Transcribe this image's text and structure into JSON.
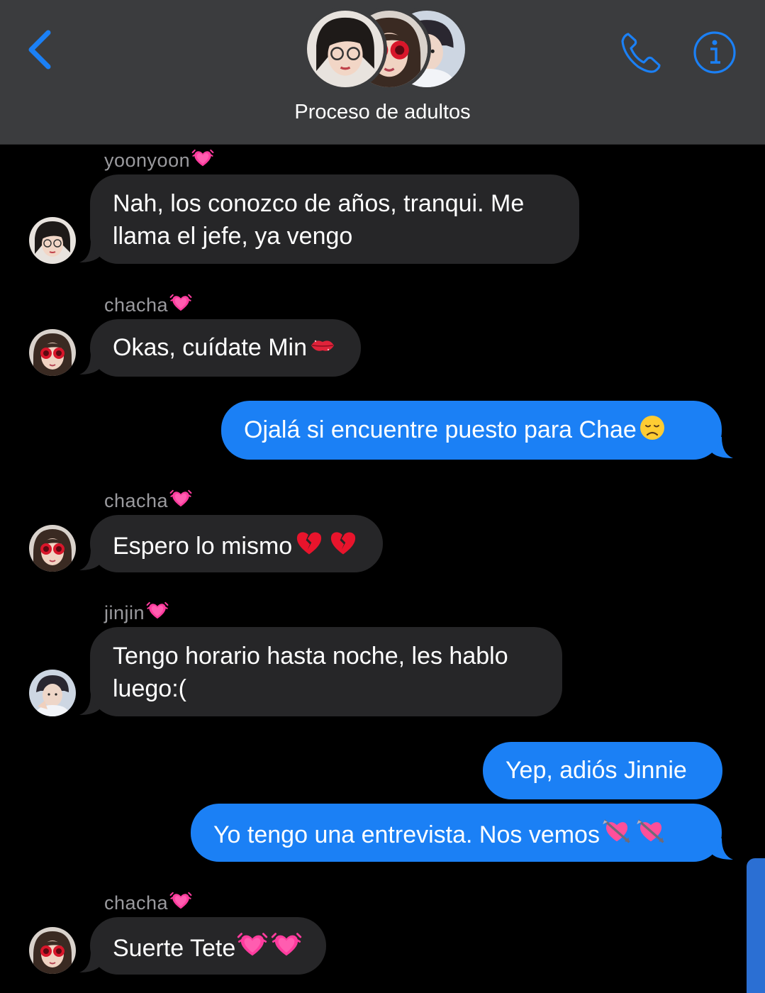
{
  "header": {
    "title": "Proceso de adultos",
    "accent": "#1b80f5",
    "icons": {
      "back": "chevron-left-icon",
      "call": "phone-icon",
      "info": "info-icon"
    }
  },
  "messages": [
    {
      "type": "in",
      "sender": "yoonyoon",
      "text": "Nah, los conozco de años, tranqui. Me llama el jefe, ya vengo"
    },
    {
      "type": "in",
      "sender": "chacha",
      "text": "Okas, cuídate Min"
    },
    {
      "type": "out",
      "text": "Ojalá si encuentre puesto para Chae"
    },
    {
      "type": "in",
      "sender": "chacha",
      "text": "Espero lo mismo"
    },
    {
      "type": "in",
      "sender": "jinjin",
      "text": "Tengo horario hasta noche, les hablo luego:("
    },
    {
      "type": "out",
      "text": "Yep, adiós Jinnie"
    },
    {
      "type": "out",
      "text": "Yo tengo una entrevista. Nos vemos"
    },
    {
      "type": "in",
      "sender": "chacha",
      "text": "Suerte Tete"
    }
  ],
  "colors": {
    "incoming_bubble": "#262628",
    "outgoing_bubble": "#1b80f5",
    "sender_name": "#9a9a9e"
  }
}
